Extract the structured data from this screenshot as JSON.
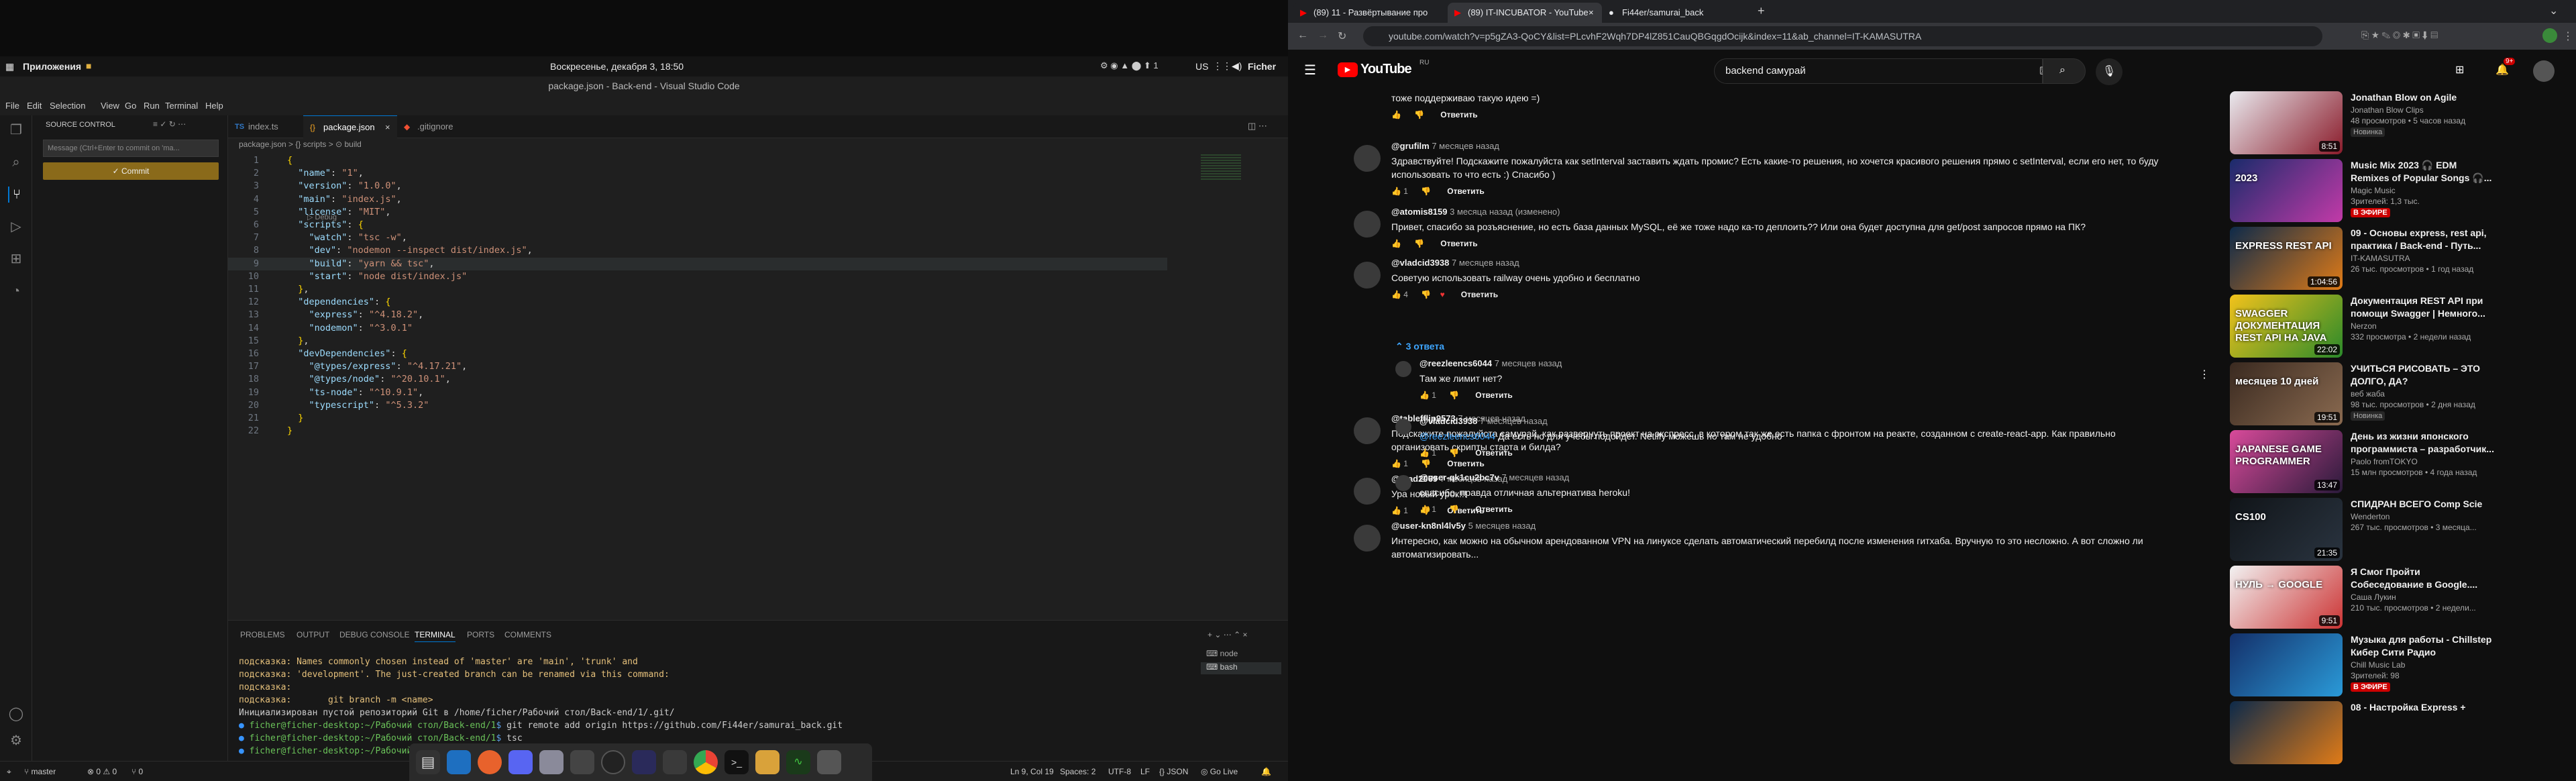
{
  "os": {
    "apps_label": "Приложения",
    "clock": "Воскресенье, декабря 3, 18:50",
    "lang": "US",
    "user": "Ficher"
  },
  "vscode": {
    "title": "package.json - Back-end - Visual Studio Code",
    "menu": [
      "File",
      "Edit",
      "Selection",
      "View",
      "Go",
      "Run",
      "Terminal",
      "Help"
    ],
    "sidebar": {
      "header": "SOURCE CONTROL",
      "message_placeholder": "Message (Ctrl+Enter to commit on 'ma...",
      "commit_label": "✓ Commit"
    },
    "tabs": [
      {
        "label": "index.ts"
      },
      {
        "label": "package.json"
      },
      {
        "label": ".gitignore"
      }
    ],
    "breadcrumb": "package.json > {} scripts > ⊙ build",
    "debug_hint": "▷ Debug",
    "code_lines": [
      {
        "n": "1",
        "tx": "{"
      },
      {
        "n": "2",
        "tx": "  \"name\": \"1\","
      },
      {
        "n": "3",
        "tx": "  \"version\": \"1.0.0\","
      },
      {
        "n": "4",
        "tx": "  \"main\": \"index.js\","
      },
      {
        "n": "5",
        "tx": "  \"license\": \"MIT\","
      },
      {
        "n": "6",
        "tx": "  \"scripts\": {"
      },
      {
        "n": "7",
        "tx": "    \"watch\": \"tsc -w\","
      },
      {
        "n": "8",
        "tx": "    \"dev\": \"nodemon --inspect dist/index.js\","
      },
      {
        "n": "9",
        "tx": "    \"build\": \"yarn && tsc\","
      },
      {
        "n": "10",
        "tx": "    \"start\": \"node dist/index.js\""
      },
      {
        "n": "11",
        "tx": "  },"
      },
      {
        "n": "12",
        "tx": "  \"dependencies\": {"
      },
      {
        "n": "13",
        "tx": "    \"express\": \"^4.18.2\","
      },
      {
        "n": "14",
        "tx": "    \"nodemon\": \"^3.0.1\""
      },
      {
        "n": "15",
        "tx": "  },"
      },
      {
        "n": "16",
        "tx": "  \"devDependencies\": {"
      },
      {
        "n": "17",
        "tx": "    \"@types/express\": \"^4.17.21\","
      },
      {
        "n": "18",
        "tx": "    \"@types/node\": \"^20.10.1\","
      },
      {
        "n": "19",
        "tx": "    \"ts-node\": \"^10.9.1\","
      },
      {
        "n": "20",
        "tx": "    \"typescript\": \"^5.3.2\""
      },
      {
        "n": "21",
        "tx": "  }"
      },
      {
        "n": "22",
        "tx": "}"
      }
    ],
    "panel_tabs": [
      "PROBLEMS",
      "OUTPUT",
      "DEBUG CONSOLE",
      "TERMINAL",
      "PORTS",
      "COMMENTS"
    ],
    "terminal_sessions": [
      "node",
      "bash"
    ],
    "terminal_lines": [
      {
        "cls": "ty",
        "tx": "подсказка: Names commonly chosen instead of 'master' are 'main', 'trunk' and"
      },
      {
        "cls": "ty",
        "tx": "подсказка: 'development'. The just-created branch can be renamed via this command:"
      },
      {
        "cls": "ty",
        "tx": "подсказка:"
      },
      {
        "cls": "ty",
        "tx": "подсказка:       git branch -m <name>"
      },
      {
        "cls": "",
        "tx": "Инициализирован пустой репозиторий Git в /home/ficher/Рабочий стол/Back-end/1/.git/"
      },
      {
        "cls": "",
        "tx": "● ficher@ficher-desktop:~/Рабочий стол/Back-end/1$ git remote add origin https://github.com/Fi44er/samurai_back.git"
      },
      {
        "cls": "",
        "tx": "● ficher@ficher-desktop:~/Рабочий стол/Back-end/1$ tsc"
      },
      {
        "cls": "",
        "tx": "● ficher@ficher-desktop:~/Рабочий стол/Back-end/1$"
      }
    ],
    "status": {
      "branch": "master",
      "errors": "⊗ 0 ⚠ 0",
      "ports": "⑂ 0",
      "position": "Ln 9, Col 19",
      "spaces": "Spaces: 2",
      "encoding": "UTF-8",
      "eol": "LF",
      "lang": "{} JSON",
      "golive": "◎ Go Live"
    }
  },
  "browser": {
    "tabs": [
      "(89) 11 - Развёртывание про",
      "(89) IT-INCUBATOR - YouTube",
      "Fi44er/samurai_back"
    ],
    "url": "youtube.com/watch?v=p5gZA3-QoCY&list=PLcvhF2Wqh7DP4lZ851CauQBGqgdOcijk&index=11&ab_channel=IT-KAMASUTRA",
    "search_query": "backend самурай",
    "logo_suffix": "RU",
    "notif_count": "9+"
  },
  "comments": [
    {
      "author": "",
      "time": "",
      "text": [
        "тоже поддерживаю такую идею =)"
      ],
      "likes": "",
      "reply": "Ответить"
    },
    {
      "author": "@grufilm",
      "time": "7 месяцев назад",
      "text": [
        "Здравствуйте! Подскажите пожалуйста как setInterval заставить ждать промис? Есть какие-то решения, но хочется красивого решения прямо с setInterval, если его нет, то буду",
        "использовать то что есть :) Спасибо )"
      ],
      "likes": "1",
      "reply": "Ответить"
    },
    {
      "author": "@atomis8159",
      "time": "3 месяца назад (изменено)",
      "text": [
        "Привет, спасибо за розъяснение, но есть база данных MySQL, её же тоже надо ка-то деплоить?? Или она будет доступна для get/post запросов прямо на ПК?"
      ],
      "likes": "",
      "reply": "Ответить"
    },
    {
      "author": "@vladcid3938",
      "time": "7 месяцев назад",
      "text": [
        "Советую использовать railway очень удобно и бесплатно"
      ],
      "likes": "4",
      "reply": "Ответить"
    },
    {
      "author": "@tablefflip9573",
      "time": "7 месяцев назад",
      "text": [
        "Подскажите пожалуйста самурай, как развернуть проект на экспресс, в котором так же есть папка с фронтом на реакте, созданном с create-react-app. Как правильно",
        "организовать скрипты старта и билда?"
      ],
      "likes": "1",
      "reply": "Ответить"
    },
    {
      "author": "@fuad2069",
      "time": "7 месяцев назад",
      "text": [
        "Ура новый урок!!!"
      ],
      "likes": "1",
      "reply": "Ответить"
    },
    {
      "author": "@user-kn8nl4lv5y",
      "time": "5 месяцев назад",
      "text": [
        "Интересно, как можно на обычном арендованном VPN на линуксе сделать автоматический перебилд после изменения гитхаба. Вручную то это несложно. А вот сложно ли",
        "автоматизировать..."
      ],
      "likes": "",
      "reply": ""
    }
  ],
  "replies_toggle": "3 ответа",
  "replies": [
    {
      "author": "@reezleencs6044",
      "time": "7 месяцев назад",
      "text": "Там же лимит нет?",
      "mention": "",
      "likes": "1",
      "reply": "Ответить"
    },
    {
      "author": "@vladcid3938",
      "time": "7 месяцев назад",
      "text": " Да есть но для учебы подойдет. Netlify можешь но там не удобно",
      "mention": "@reezleencs6044",
      "likes": "1",
      "reply": "Ответить"
    },
    {
      "author": "@user-qk1cu2bc7v",
      "time": "7 месяцев назад",
      "text": "спасибо, правда отличная альтернатива heroku!",
      "mention": "",
      "likes": "1",
      "reply": "Ответить"
    }
  ],
  "recommendations": [
    {
      "title": [
        "Jonathan Blow on Agile"
      ],
      "channel": "Jonathan Blow Clips",
      "meta": "48 просмотров • 5 часов назад",
      "badge": "Новинка",
      "dur": "8:51",
      "thumb_text": "",
      "c1": "#e9e9ee",
      "c2": "#8a1b2a"
    },
    {
      "title": [
        "Music Mix 2023 🎧 EDM",
        "Remixes of Popular Songs 🎧..."
      ],
      "channel": "Magic Music",
      "meta": "Зрителей: 1,3 тыс.",
      "badge": "В ЭФИРЕ",
      "dur": "",
      "thumb_text": "2023",
      "c1": "#1a2b6b",
      "c2": "#c23aa8"
    },
    {
      "title": [
        "09 - Основы express, rest api,",
        "практика / Back-end - Путь..."
      ],
      "channel": "IT-KAMASUTRA",
      "meta": "26 тыс. просмотров • 1 год назад",
      "badge": "",
      "dur": "1:04:56",
      "thumb_text": "EXPRESS REST API",
      "c1": "#0d2a4a",
      "c2": "#e07b17"
    },
    {
      "title": [
        "Документация REST API при",
        "помощи Swagger | Немного..."
      ],
      "channel": "Nerzon",
      "meta": "332 просмотра • 2 недели назад",
      "badge": "",
      "dur": "22:02",
      "thumb_text": "SWAGGER ДОКУМЕНТАЦИЯ REST API НА JAVA",
      "c1": "#f2c21b",
      "c2": "#2a8a2a"
    },
    {
      "title": [
        "УЧИТЬСЯ РИСОВАТЬ – ЭТО",
        "ДОЛГО, ДА?"
      ],
      "channel": "веб жаба",
      "meta": "98 тыс. просмотров • 2 дня назад",
      "badge": "Новинка",
      "dur": "19:51",
      "thumb_text": "месяцев 10 дней",
      "c1": "#3a2a20",
      "c2": "#8a6a50"
    },
    {
      "title": [
        "День из жизни японского",
        "программиста – разработчик..."
      ],
      "channel": "Paolo fromTOKYO",
      "meta": "15 млн просмотров • 4 года назад",
      "badge": "",
      "dur": "13:47",
      "thumb_text": "JAPANESE GAME PROGRAMMER",
      "c1": "#d84a9a",
      "c2": "#2a1a3a"
    },
    {
      "title": [
        "СПИДРАН ВСЕГО Comp Scie"
      ],
      "channel": "Wenderton",
      "meta": "267 тыс. просмотров • 3 месяца...",
      "badge": "",
      "dur": "21:35",
      "thumb_text": "CS100",
      "c1": "#101418",
      "c2": "#2a3440"
    },
    {
      "title": [
        "Я Смог Пройти",
        "Собеседование в Google...."
      ],
      "channel": "Саша Лукин",
      "meta": "210 тыс. просмотров • 2 недели...",
      "badge": "",
      "dur": "9:51",
      "thumb_text": "НУЛЬ → GOOGLE",
      "c1": "#f2f2f2",
      "c2": "#c33"
    },
    {
      "title": [
        "Музыка для работы - Chillstep",
        "Кибер Сити Радио"
      ],
      "channel": "Chill Music Lab",
      "meta": "Зрителей: 98",
      "badge": "В ЭФИРЕ",
      "dur": "",
      "thumb_text": "",
      "c1": "#14306a",
      "c2": "#2a9ad8"
    },
    {
      "title": [
        "08 - Настройка Express +"
      ],
      "channel": "",
      "meta": "",
      "badge": "",
      "dur": "",
      "thumb_text": "",
      "c1": "#0d2a4a",
      "c2": "#e07b17"
    }
  ]
}
